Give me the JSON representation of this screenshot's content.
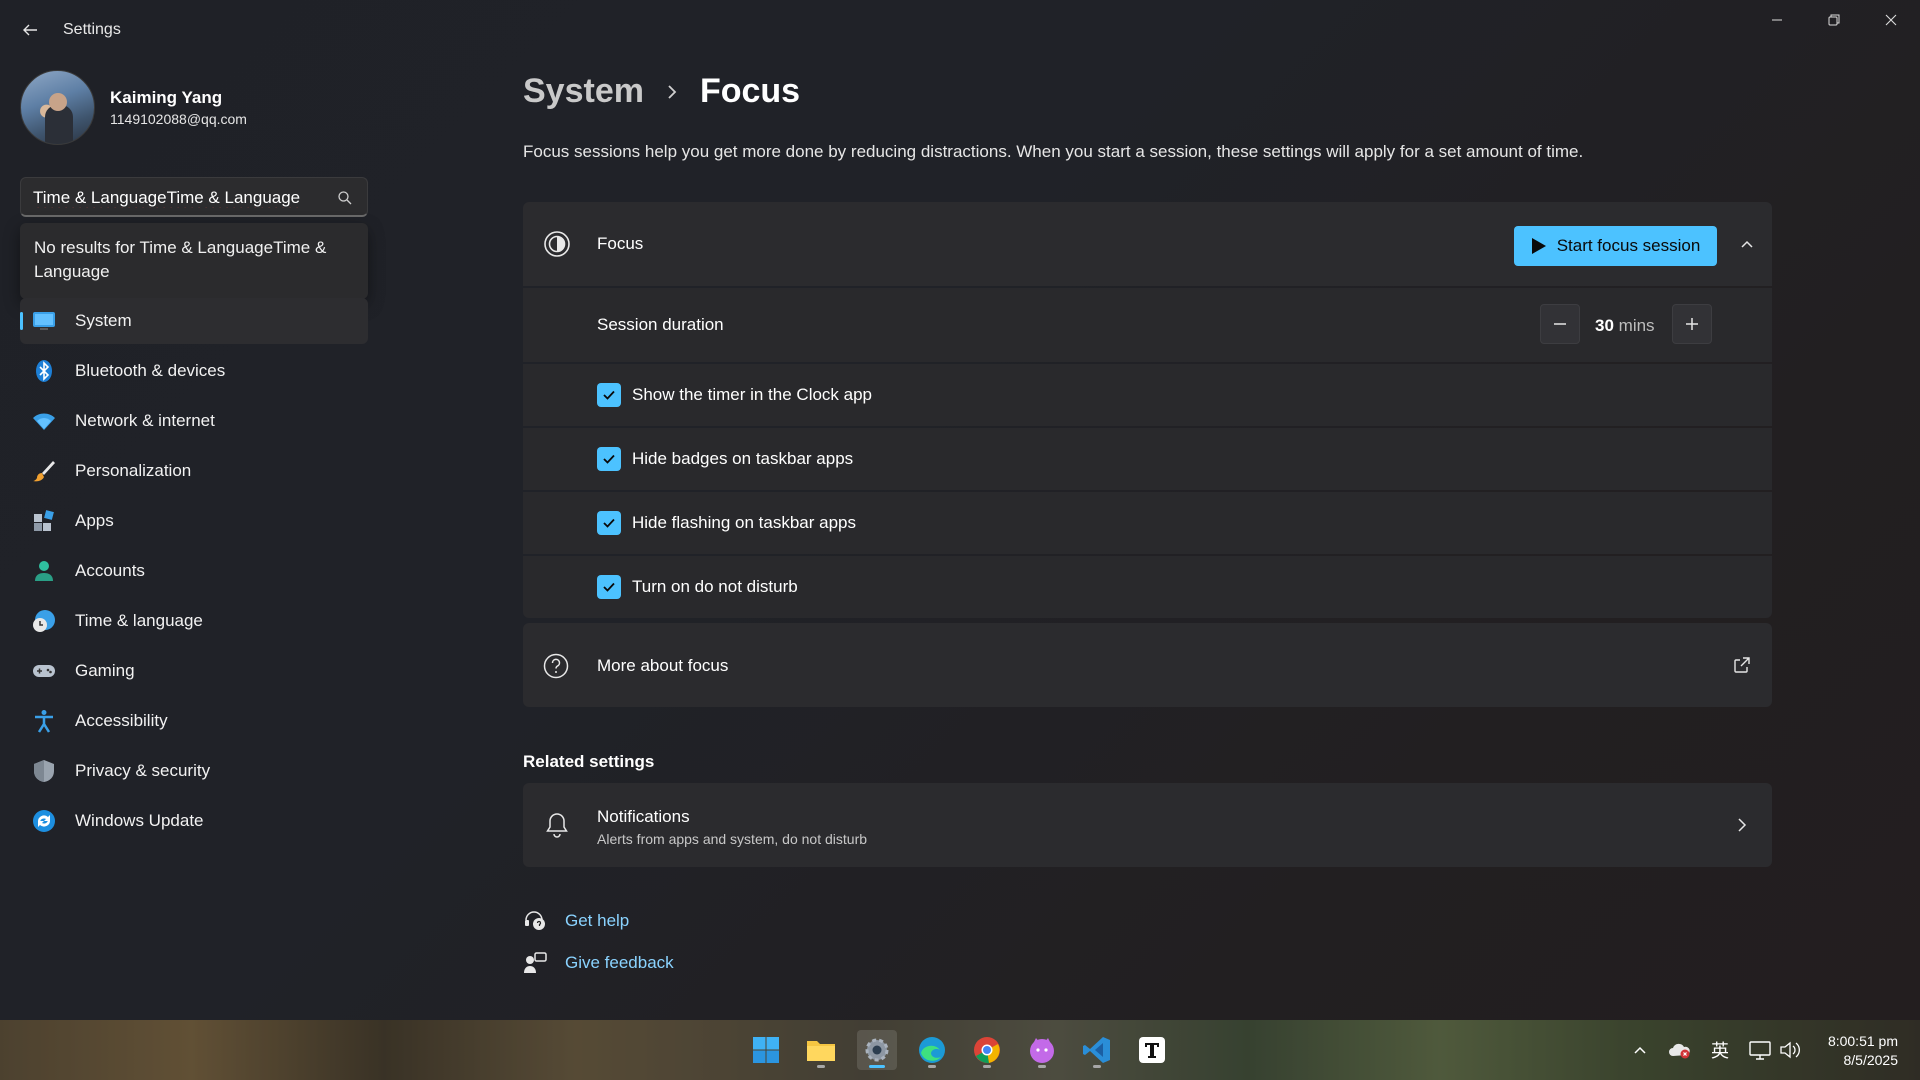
{
  "app": {
    "title": "Settings"
  },
  "profile": {
    "name": "Kaiming Yang",
    "email": "1149102088@qq.com"
  },
  "search": {
    "value": "Time & LanguageTime & Language",
    "no_results": "No results for Time & LanguageTime & Language"
  },
  "sidebar": {
    "items": [
      {
        "label": "System",
        "icon": "monitor-icon",
        "selected": true
      },
      {
        "label": "Bluetooth & devices",
        "icon": "bluetooth-icon"
      },
      {
        "label": "Network & internet",
        "icon": "wifi-icon"
      },
      {
        "label": "Personalization",
        "icon": "brush-icon"
      },
      {
        "label": "Apps",
        "icon": "apps-icon"
      },
      {
        "label": "Accounts",
        "icon": "person-icon"
      },
      {
        "label": "Time & language",
        "icon": "globe-clock-icon"
      },
      {
        "label": "Gaming",
        "icon": "gamepad-icon"
      },
      {
        "label": "Accessibility",
        "icon": "accessibility-icon"
      },
      {
        "label": "Privacy & security",
        "icon": "shield-icon"
      },
      {
        "label": "Windows Update",
        "icon": "update-icon"
      }
    ]
  },
  "breadcrumb": {
    "parent": "System",
    "current": "Focus"
  },
  "description": "Focus sessions help you get more done by reducing distractions. When you start a session, these settings will apply for a set amount of time.",
  "focus": {
    "title": "Focus",
    "start_button": "Start focus session",
    "duration_label": "Session duration",
    "duration_value": "30",
    "duration_unit": "mins",
    "options": [
      {
        "label": "Show the timer in the Clock app",
        "checked": true
      },
      {
        "label": "Hide badges on taskbar apps",
        "checked": true
      },
      {
        "label": "Hide flashing on taskbar apps",
        "checked": true
      },
      {
        "label": "Turn on do not disturb",
        "checked": true
      }
    ]
  },
  "more_about": {
    "label": "More about focus"
  },
  "related": {
    "heading": "Related settings",
    "notifications_title": "Notifications",
    "notifications_sub": "Alerts from apps and system, do not disturb"
  },
  "help": {
    "get_help": "Get help",
    "give_feedback": "Give feedback"
  },
  "taskbar": {
    "ime": "英",
    "time": "8:00:51 pm",
    "date": "8/5/2025"
  },
  "colors": {
    "accent": "#4cc2ff",
    "background": "#202124",
    "card": "#2b2b2e"
  }
}
